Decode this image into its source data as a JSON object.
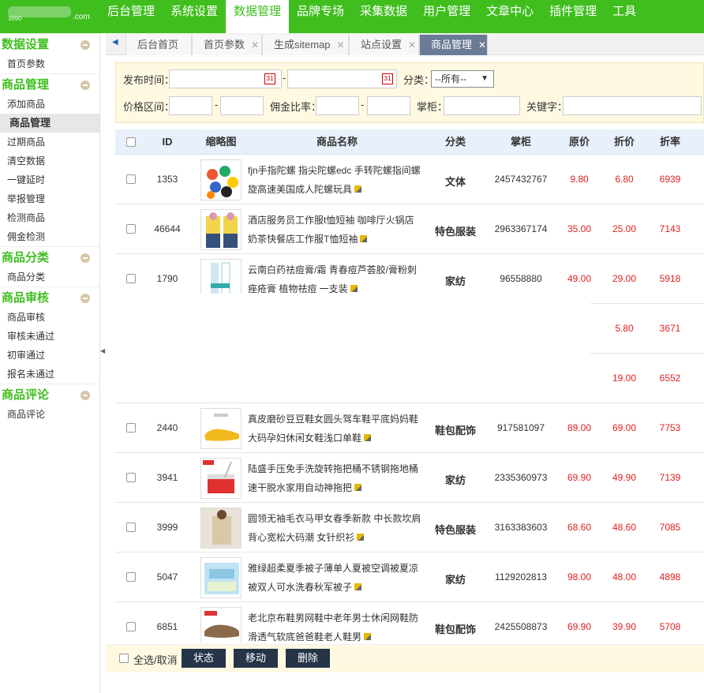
{
  "logo": {
    "sub": "3690",
    "com": ".com"
  },
  "topnav": [
    "后台管理",
    "系统设置",
    "数据管理",
    "品牌专场",
    "采集数据",
    "用户管理",
    "文章中心",
    "插件管理",
    "工具"
  ],
  "topnav_active": 2,
  "sidebar": [
    {
      "title": "数据设置",
      "items": [
        "首页参数"
      ]
    },
    {
      "title": "商品管理",
      "items": [
        "添加商品",
        "商品管理",
        "过期商品",
        "清空数据",
        "一键延时",
        "举报管理",
        "检测商品",
        "佣金检测"
      ]
    },
    {
      "title": "商品分类",
      "items": [
        "商品分类"
      ]
    },
    {
      "title": "商品审核",
      "items": [
        "商品审核",
        "审核未通过",
        "初审通过",
        "报名未通过"
      ]
    },
    {
      "title": "商品评论",
      "items": [
        "商品评论"
      ]
    }
  ],
  "sidebar_active": "商品管理",
  "tabs": [
    {
      "label": "后台首页",
      "close": false
    },
    {
      "label": "首页参数",
      "close": true
    },
    {
      "label": "生成sitemap",
      "close": true
    },
    {
      "label": "站点设置",
      "close": true
    },
    {
      "label": "商品管理",
      "close": true
    }
  ],
  "filter": {
    "publish_time": "发布时间：",
    "category": "分类：",
    "category_value": "--所有--",
    "price_range": "价格区间：",
    "commission": "佣金比率：",
    "shopkeeper": "掌柜：",
    "keyword": "关键字：",
    "dash": "-"
  },
  "columns": [
    "ID",
    "缩略图",
    "商品名称",
    "分类",
    "掌柜",
    "原价",
    "折价",
    "折率"
  ],
  "rows": [
    {
      "id": "1353",
      "name": "fjn手指陀螺 指尖陀螺edc 手转陀螺指间螺旋高速美国成人陀螺玩具",
      "cat": "文体",
      "keeper": "2457432767",
      "orig": "9.80",
      "disc": "6.80",
      "rate": "6939",
      "thumb": "spinner"
    },
    {
      "id": "46644",
      "name": "酒店服务员工作服t恤短袖 咖啡厅火锅店奶茶快餐店工作服T恤短袖",
      "cat": "特色服装",
      "keeper": "2963367174",
      "orig": "35.00",
      "disc": "25.00",
      "rate": "7143",
      "thumb": "uniform"
    },
    {
      "id": "1790",
      "name": "云南白药祛痘膏/霜 青春痘芦荟胶/膏粉刺痤疮膏 植物祛痘 一支装",
      "cat": "家纺",
      "keeper": "96558880",
      "orig": "49.00",
      "disc": "29.00",
      "rate": "5918",
      "thumb": "tube"
    },
    {
      "id": "",
      "name": "",
      "cat": "",
      "keeper": "",
      "orig": "",
      "disc": "5.80",
      "rate": "3671",
      "thumb": ""
    },
    {
      "id": "",
      "name": "",
      "cat": "",
      "keeper": "",
      "orig": "",
      "disc": "19.00",
      "rate": "6552",
      "thumb": ""
    },
    {
      "id": "2440",
      "name": "真皮磨砂豆豆鞋女圆头驾车鞋平底妈妈鞋大码孕妇休闲女鞋浅口单鞋",
      "cat": "鞋包配饰",
      "keeper": "917581097",
      "orig": "89.00",
      "disc": "69.00",
      "rate": "7753",
      "thumb": "shoe"
    },
    {
      "id": "3941",
      "name": "陆盛手压免手洗旋转拖把桶不锈钢拖地桶速干脱水家用自动神拖把",
      "cat": "家纺",
      "keeper": "2335360973",
      "orig": "69.90",
      "disc": "49.90",
      "rate": "7139",
      "thumb": "mop"
    },
    {
      "id": "3999",
      "name": "圆领无袖毛衣马甲女春季新款 中长款坎肩背心宽松大码潮 女针织衫",
      "cat": "特色服装",
      "keeper": "3163383603",
      "orig": "68.60",
      "disc": "48.60",
      "rate": "7085",
      "thumb": "sweater"
    },
    {
      "id": "5047",
      "name": "雅绿超柔夏季被子薄单人夏被空调被夏凉被双人可水洗春秋军被子",
      "cat": "家纺",
      "keeper": "1129202813",
      "orig": "98.00",
      "disc": "48.00",
      "rate": "4898",
      "thumb": "quilt"
    },
    {
      "id": "6851",
      "name": "老北京布鞋男网鞋中老年男士休闲网鞋防滑透气软底爸爸鞋老人鞋男",
      "cat": "鞋包配饰",
      "keeper": "2425508873",
      "orig": "69.90",
      "disc": "39.90",
      "rate": "5708",
      "thumb": "mensshoe"
    }
  ],
  "bottom": {
    "select_all": "全选/取消",
    "status": "状态",
    "move": "移动",
    "delete": "删除"
  },
  "colors": {
    "green": "#3fbe1e",
    "red": "#e02020",
    "dark_btn": "#253447"
  }
}
